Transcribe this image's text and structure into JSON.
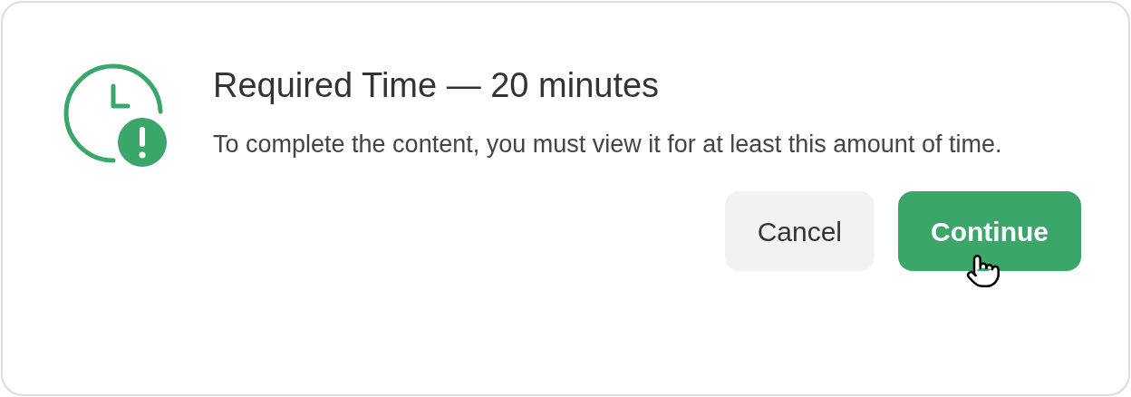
{
  "dialog": {
    "title": "Required Time — 20 minutes",
    "message": "To complete the content, you must view it for at least this amount of time.",
    "buttons": [
      {
        "label": "Cancel",
        "kind": "secondary"
      },
      {
        "label": "Continue",
        "kind": "primary"
      }
    ]
  }
}
